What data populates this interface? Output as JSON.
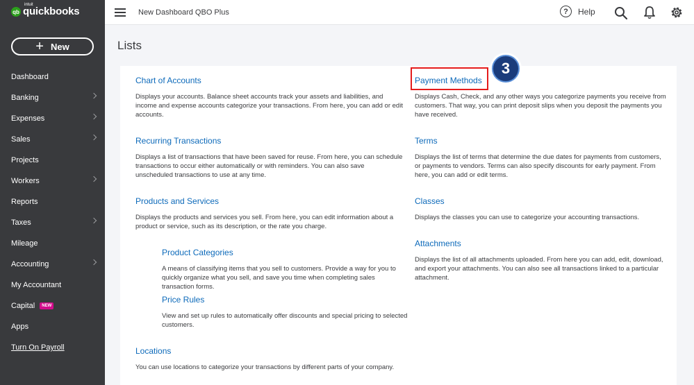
{
  "brand": {
    "logo": "qb",
    "intuit": "intuit",
    "name": "quickbooks"
  },
  "sidebar": {
    "new_label": "New",
    "items": [
      {
        "label": "Dashboard",
        "chevron": false
      },
      {
        "label": "Banking",
        "chevron": true
      },
      {
        "label": "Expenses",
        "chevron": true
      },
      {
        "label": "Sales",
        "chevron": true
      },
      {
        "label": "Projects",
        "chevron": false
      },
      {
        "label": "Workers",
        "chevron": true
      },
      {
        "label": "Reports",
        "chevron": false
      },
      {
        "label": "Taxes",
        "chevron": true
      },
      {
        "label": "Mileage",
        "chevron": false
      },
      {
        "label": "Accounting",
        "chevron": true
      },
      {
        "label": "My Accountant",
        "chevron": false
      },
      {
        "label": "Capital",
        "chevron": false,
        "badge": "NEW"
      },
      {
        "label": "Apps",
        "chevron": false
      },
      {
        "label": "Turn On Payroll",
        "chevron": false
      }
    ]
  },
  "topbar": {
    "company": "New Dashboard QBO Plus",
    "help_label": "Help",
    "help_icon": "?"
  },
  "page": {
    "title": "Lists"
  },
  "lists": {
    "chart_of_accounts": {
      "title": "Chart of Accounts",
      "desc": "Displays your accounts. Balance sheet accounts track your assets and liabilities, and income and expense accounts categorize your transactions. From here, you can add or edit accounts."
    },
    "recurring": {
      "title": "Recurring Transactions",
      "desc": "Displays a list of transactions that have been saved for reuse. From here, you can schedule transactions to occur either automatically or with reminders. You can also save unscheduled transactions to use at any time."
    },
    "products": {
      "title": "Products and Services",
      "desc": "Displays the products and services you sell. From here, you can edit information about a product or service, such as its description, or the rate you charge."
    },
    "product_categories": {
      "title": "Product Categories",
      "desc": "A means of classifying items that you sell to customers. Provide a way for you to quickly organize what you sell, and save you time when completing sales transaction forms."
    },
    "price_rules": {
      "title": "Price Rules",
      "desc": "View and set up rules to automatically offer discounts and special pricing to selected customers."
    },
    "locations": {
      "title": "Locations",
      "desc": "You can use locations to categorize your transactions by different parts of your company."
    },
    "payment_methods": {
      "title": "Payment Methods",
      "desc": "Displays Cash, Check, and any other ways you categorize payments you receive from customers. That way, you can print deposit slips when you deposit the payments you have received."
    },
    "terms": {
      "title": "Terms",
      "desc": "Displays the list of terms that determine the due dates for payments from customers, or payments to vendors. Terms can also specify discounts for early payment. From here, you can add or edit terms."
    },
    "classes": {
      "title": "Classes",
      "desc": "Displays the classes you can use to categorize your accounting transactions."
    },
    "attachments": {
      "title": "Attachments",
      "desc": "Displays the list of all attachments uploaded. From here you can add, edit, download, and export your attachments. You can also see all transactions linked to a particular attachment."
    }
  },
  "annotation": {
    "step": "3",
    "highlight_color": "#e41b1b",
    "badge_color": "#1b3c7b"
  },
  "colors": {
    "sidebar": "#393a3d",
    "link": "#0d6aba",
    "brand_green": "#2ca01c",
    "new_badge": "#d30c8c"
  },
  "icons": {
    "search": "search-icon",
    "notifications": "bell-icon",
    "settings": "gear-icon",
    "menu": "hamburger-icon",
    "help": "help-icon"
  }
}
